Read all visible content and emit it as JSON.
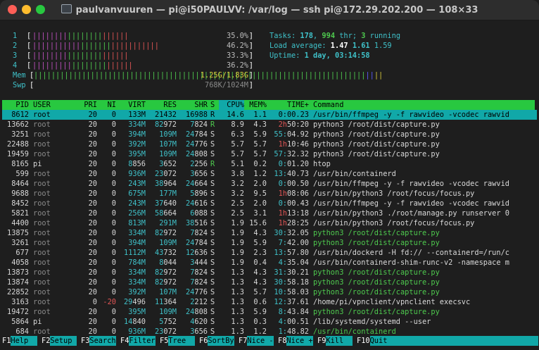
{
  "window": {
    "title": "paulvanvuuren — pi@i50PAULVV: /var/log — ssh pi@172.29.202.200 — 108×33"
  },
  "meters": {
    "cpus": [
      {
        "label": "1",
        "bars": "||||||||||||||||||||||",
        "percent": "35.0%"
      },
      {
        "label": "2",
        "bars": "|||||||||||||||||||||||||||||",
        "percent": "46.2%"
      },
      {
        "label": "3",
        "bars": "||||||||||||||||||||||",
        "percent": "33.3%"
      },
      {
        "label": "4",
        "bars": "|||||||||||||||||||||||",
        "percent": "36.2%"
      }
    ],
    "mem": {
      "label": "Mem",
      "bars": "||||||||||||||||||||||||||||||||||||||||||||||||||||||||||||||||||||||||||||||||",
      "value": "1.25G/1.83G"
    },
    "swp": {
      "label": "Swp",
      "bars": "",
      "value": "768K/1024M"
    }
  },
  "summary": {
    "tasks_label": "Tasks: ",
    "tasks": "178",
    "sep1": ", ",
    "threads": "994",
    "thr_label": " thr; ",
    "running": "3",
    "running_label": " running",
    "load_label": "Load average: ",
    "load1": "1.47",
    "load5": "1.61",
    "load15": "1.59",
    "uptime_label": "Uptime: ",
    "uptime": "1 day, 03:14:58"
  },
  "table": {
    "headers": {
      "pid": "PID",
      "user": "USER",
      "pri": "PRI",
      "ni": "NI",
      "virt": "VIRT",
      "res": "RES",
      "shr": "SHR",
      "s": "S",
      "cpu": "CPU%",
      "mem": "MEM%",
      "time": "TIME+",
      "command": "Command"
    },
    "rows": [
      {
        "pid": "8612",
        "user": "root",
        "pri": "20",
        "ni": "0",
        "virt": "133M",
        "res": "21432",
        "shr": "16988",
        "s": "R",
        "cpu": "14.6",
        "mem": "1.1",
        "time": "0:00.23",
        "command": "/usr/bin/ffmpeg -y -f rawvideo -vcodec rawvid"
      },
      {
        "pid": "13662",
        "user": "root",
        "pri": "20",
        "ni": "0",
        "virt": "334M",
        "res": "82972",
        "shr": "7824",
        "s": "R",
        "cpu": "8.9",
        "mem": "4.3",
        "time": "2h50:20",
        "command": "python3 /root/dist/capture.py"
      },
      {
        "pid": "3251",
        "user": "root",
        "pri": "20",
        "ni": "0",
        "virt": "394M",
        "res": "109M",
        "shr": "24784",
        "s": "S",
        "cpu": "6.3",
        "mem": "5.9",
        "time": "55:04.92",
        "command": "python3 /root/dist/capture.py"
      },
      {
        "pid": "22488",
        "user": "root",
        "pri": "20",
        "ni": "0",
        "virt": "392M",
        "res": "107M",
        "shr": "24776",
        "s": "S",
        "cpu": "5.7",
        "mem": "5.7",
        "time": "1h10:46",
        "command": "python3 /root/dist/capture.py"
      },
      {
        "pid": "19459",
        "user": "root",
        "pri": "20",
        "ni": "0",
        "virt": "395M",
        "res": "109M",
        "shr": "24808",
        "s": "S",
        "cpu": "5.7",
        "mem": "5.7",
        "time": "57:32.32",
        "command": "python3 /root/dist/capture.py"
      },
      {
        "pid": "8165",
        "user": "pi",
        "pri": "20",
        "ni": "0",
        "virt": "8856",
        "res": "3652",
        "shr": "2256",
        "s": "R",
        "cpu": "5.1",
        "mem": "0.2",
        "time": "0:01.20",
        "command": "htop"
      },
      {
        "pid": "599",
        "user": "root",
        "pri": "20",
        "ni": "0",
        "virt": "936M",
        "res": "23072",
        "shr": "3656",
        "s": "S",
        "cpu": "3.8",
        "mem": "1.2",
        "time": "13:40.73",
        "command": "/usr/bin/containerd"
      },
      {
        "pid": "8464",
        "user": "root",
        "pri": "20",
        "ni": "0",
        "virt": "243M",
        "res": "38964",
        "shr": "24664",
        "s": "S",
        "cpu": "3.2",
        "mem": "2.0",
        "time": "0:00.50",
        "command": "/usr/bin/ffmpeg -y -f rawvideo -vcodec rawvid"
      },
      {
        "pid": "9688",
        "user": "root",
        "pri": "20",
        "ni": "0",
        "virt": "675M",
        "res": "177M",
        "shr": "5896",
        "s": "S",
        "cpu": "3.2",
        "mem": "9.5",
        "time": "1h08:06",
        "command": "/usr/bin/python3 /root/focus/focus.py"
      },
      {
        "pid": "8452",
        "user": "root",
        "pri": "20",
        "ni": "0",
        "virt": "243M",
        "res": "37640",
        "shr": "24616",
        "s": "S",
        "cpu": "2.5",
        "mem": "2.0",
        "time": "0:00.43",
        "command": "/usr/bin/ffmpeg -y -f rawvideo -vcodec rawvid"
      },
      {
        "pid": "5821",
        "user": "root",
        "pri": "20",
        "ni": "0",
        "virt": "256M",
        "res": "58664",
        "shr": "6088",
        "s": "S",
        "cpu": "2.5",
        "mem": "3.1",
        "time": "1h13:18",
        "command": "/usr/bin/python3 ./root/manage.py runserver 0"
      },
      {
        "pid": "4400",
        "user": "root",
        "pri": "20",
        "ni": "0",
        "virt": "813M",
        "res": "291M",
        "shr": "38516",
        "s": "S",
        "cpu": "1.9",
        "mem": "15.6",
        "time": "1h28:25",
        "command": "/usr/bin/python3 /root/focus/focus.py"
      },
      {
        "pid": "13875",
        "user": "root",
        "pri": "20",
        "ni": "0",
        "virt": "334M",
        "res": "82972",
        "shr": "7824",
        "s": "S",
        "cpu": "1.9",
        "mem": "4.3",
        "time": "30:32.05",
        "command": "python3 /root/dist/capture.py"
      },
      {
        "pid": "3261",
        "user": "root",
        "pri": "20",
        "ni": "0",
        "virt": "394M",
        "res": "109M",
        "shr": "24784",
        "s": "S",
        "cpu": "1.9",
        "mem": "5.9",
        "time": "7:42.00",
        "command": "python3 /root/dist/capture.py"
      },
      {
        "pid": "677",
        "user": "root",
        "pri": "20",
        "ni": "0",
        "virt": "1112M",
        "res": "43732",
        "shr": "12636",
        "s": "S",
        "cpu": "1.9",
        "mem": "2.3",
        "time": "13:57.80",
        "command": "/usr/bin/dockerd -H fd:// --containerd=/run/c"
      },
      {
        "pid": "4058",
        "user": "root",
        "pri": "20",
        "ni": "0",
        "virt": "784M",
        "res": "8044",
        "shr": "3444",
        "s": "S",
        "cpu": "1.9",
        "mem": "0.4",
        "time": "4:35.04",
        "command": "/usr/bin/containerd-shim-runc-v2 -namespace m"
      },
      {
        "pid": "13873",
        "user": "root",
        "pri": "20",
        "ni": "0",
        "virt": "334M",
        "res": "82972",
        "shr": "7824",
        "s": "S",
        "cpu": "1.3",
        "mem": "4.3",
        "time": "31:30.21",
        "command": "python3 /root/dist/capture.py"
      },
      {
        "pid": "13874",
        "user": "root",
        "pri": "20",
        "ni": "0",
        "virt": "334M",
        "res": "82972",
        "shr": "7824",
        "s": "S",
        "cpu": "1.3",
        "mem": "4.3",
        "time": "30:58.18",
        "command": "python3 /root/dist/capture.py"
      },
      {
        "pid": "22852",
        "user": "root",
        "pri": "20",
        "ni": "0",
        "virt": "392M",
        "res": "107M",
        "shr": "24776",
        "s": "S",
        "cpu": "1.3",
        "mem": "5.7",
        "time": "10:58.03",
        "command": "python3 /root/dist/capture.py"
      },
      {
        "pid": "3163",
        "user": "root",
        "pri": "0",
        "ni": "-20",
        "virt": "29496",
        "res": "11364",
        "shr": "2212",
        "s": "S",
        "cpu": "1.3",
        "mem": "0.6",
        "time": "12:37.61",
        "command": "/home/pi/vpnclient/vpnclient execsvc"
      },
      {
        "pid": "19472",
        "user": "root",
        "pri": "20",
        "ni": "0",
        "virt": "395M",
        "res": "109M",
        "shr": "24808",
        "s": "S",
        "cpu": "1.3",
        "mem": "5.9",
        "time": "8:43.84",
        "command": "python3 /root/dist/capture.py"
      },
      {
        "pid": "5864",
        "user": "pi",
        "pri": "20",
        "ni": "0",
        "virt": "14840",
        "res": "5752",
        "shr": "4620",
        "s": "S",
        "cpu": "1.3",
        "mem": "0.3",
        "time": "4:00.51",
        "command": "/lib/systemd/systemd --user"
      },
      {
        "pid": "684",
        "user": "root",
        "pri": "20",
        "ni": "0",
        "virt": "936M",
        "res": "23072",
        "shr": "3656",
        "s": "S",
        "cpu": "1.3",
        "mem": "1.2",
        "time": "1:48.82",
        "command": "/usr/bin/containerd"
      }
    ]
  },
  "fkeys": [
    {
      "key": "F1",
      "label": "Help  "
    },
    {
      "key": "F2",
      "label": "Setup "
    },
    {
      "key": "F3",
      "label": "Search"
    },
    {
      "key": "F4",
      "label": "Filter"
    },
    {
      "key": "F5",
      "label": "Tree  "
    },
    {
      "key": "F6",
      "label": "SortBy"
    },
    {
      "key": "F7",
      "label": "Nice -"
    },
    {
      "key": "F8",
      "label": "Nice +"
    },
    {
      "key": "F9",
      "label": "Kill  "
    },
    {
      "key": "F10",
      "label": "Quit"
    }
  ],
  "colors": {
    "header_bg": "#28c840",
    "selected_bg": "#11a8a8",
    "fkey_bg": "#11a8a8"
  }
}
